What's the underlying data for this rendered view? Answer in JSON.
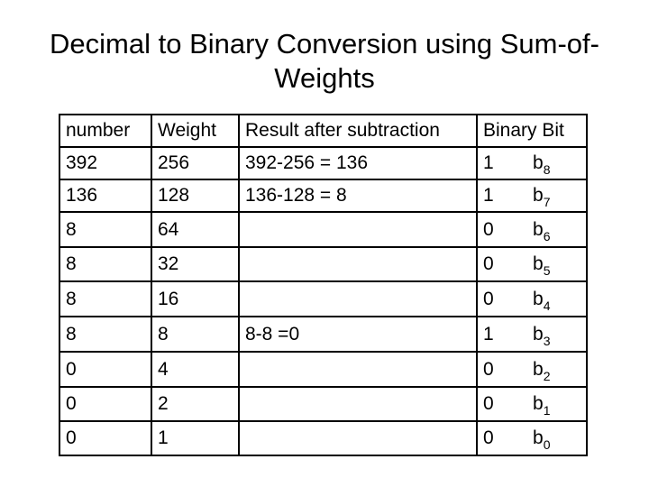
{
  "title_line1": "Decimal to Binary Conversion using Sum-of-",
  "title_line2": "Weights",
  "table": {
    "headers": [
      "number",
      "Weight",
      "Result after subtraction",
      "Binary Bit"
    ],
    "rows": [
      {
        "number": "392",
        "weight": "256",
        "result": "392-256 = 136",
        "bit": "1",
        "bit_base": "b",
        "bit_index": "8"
      },
      {
        "number": "136",
        "weight": "128",
        "result": "136-128 = 8",
        "bit": "1",
        "bit_base": "b",
        "bit_index": "7"
      },
      {
        "number": "8",
        "weight": "64",
        "result": "",
        "bit": "0",
        "bit_base": "b",
        "bit_index": "6"
      },
      {
        "number": "8",
        "weight": "32",
        "result": "",
        "bit": "0",
        "bit_base": "b",
        "bit_index": "5"
      },
      {
        "number": "8",
        "weight": "16",
        "result": "",
        "bit": "0",
        "bit_base": "b",
        "bit_index": "4"
      },
      {
        "number": "8",
        "weight": "8",
        "result": "8-8 =0",
        "bit": "1",
        "bit_base": "b",
        "bit_index": "3"
      },
      {
        "number": "0",
        "weight": "4",
        "result": "",
        "bit": "0",
        "bit_base": "b",
        "bit_index": "2"
      },
      {
        "number": "0",
        "weight": "2",
        "result": "",
        "bit": "0",
        "bit_base": "b",
        "bit_index": "1"
      },
      {
        "number": "0",
        "weight": "1",
        "result": "",
        "bit": "0",
        "bit_base": "b",
        "bit_index": "0"
      }
    ]
  }
}
